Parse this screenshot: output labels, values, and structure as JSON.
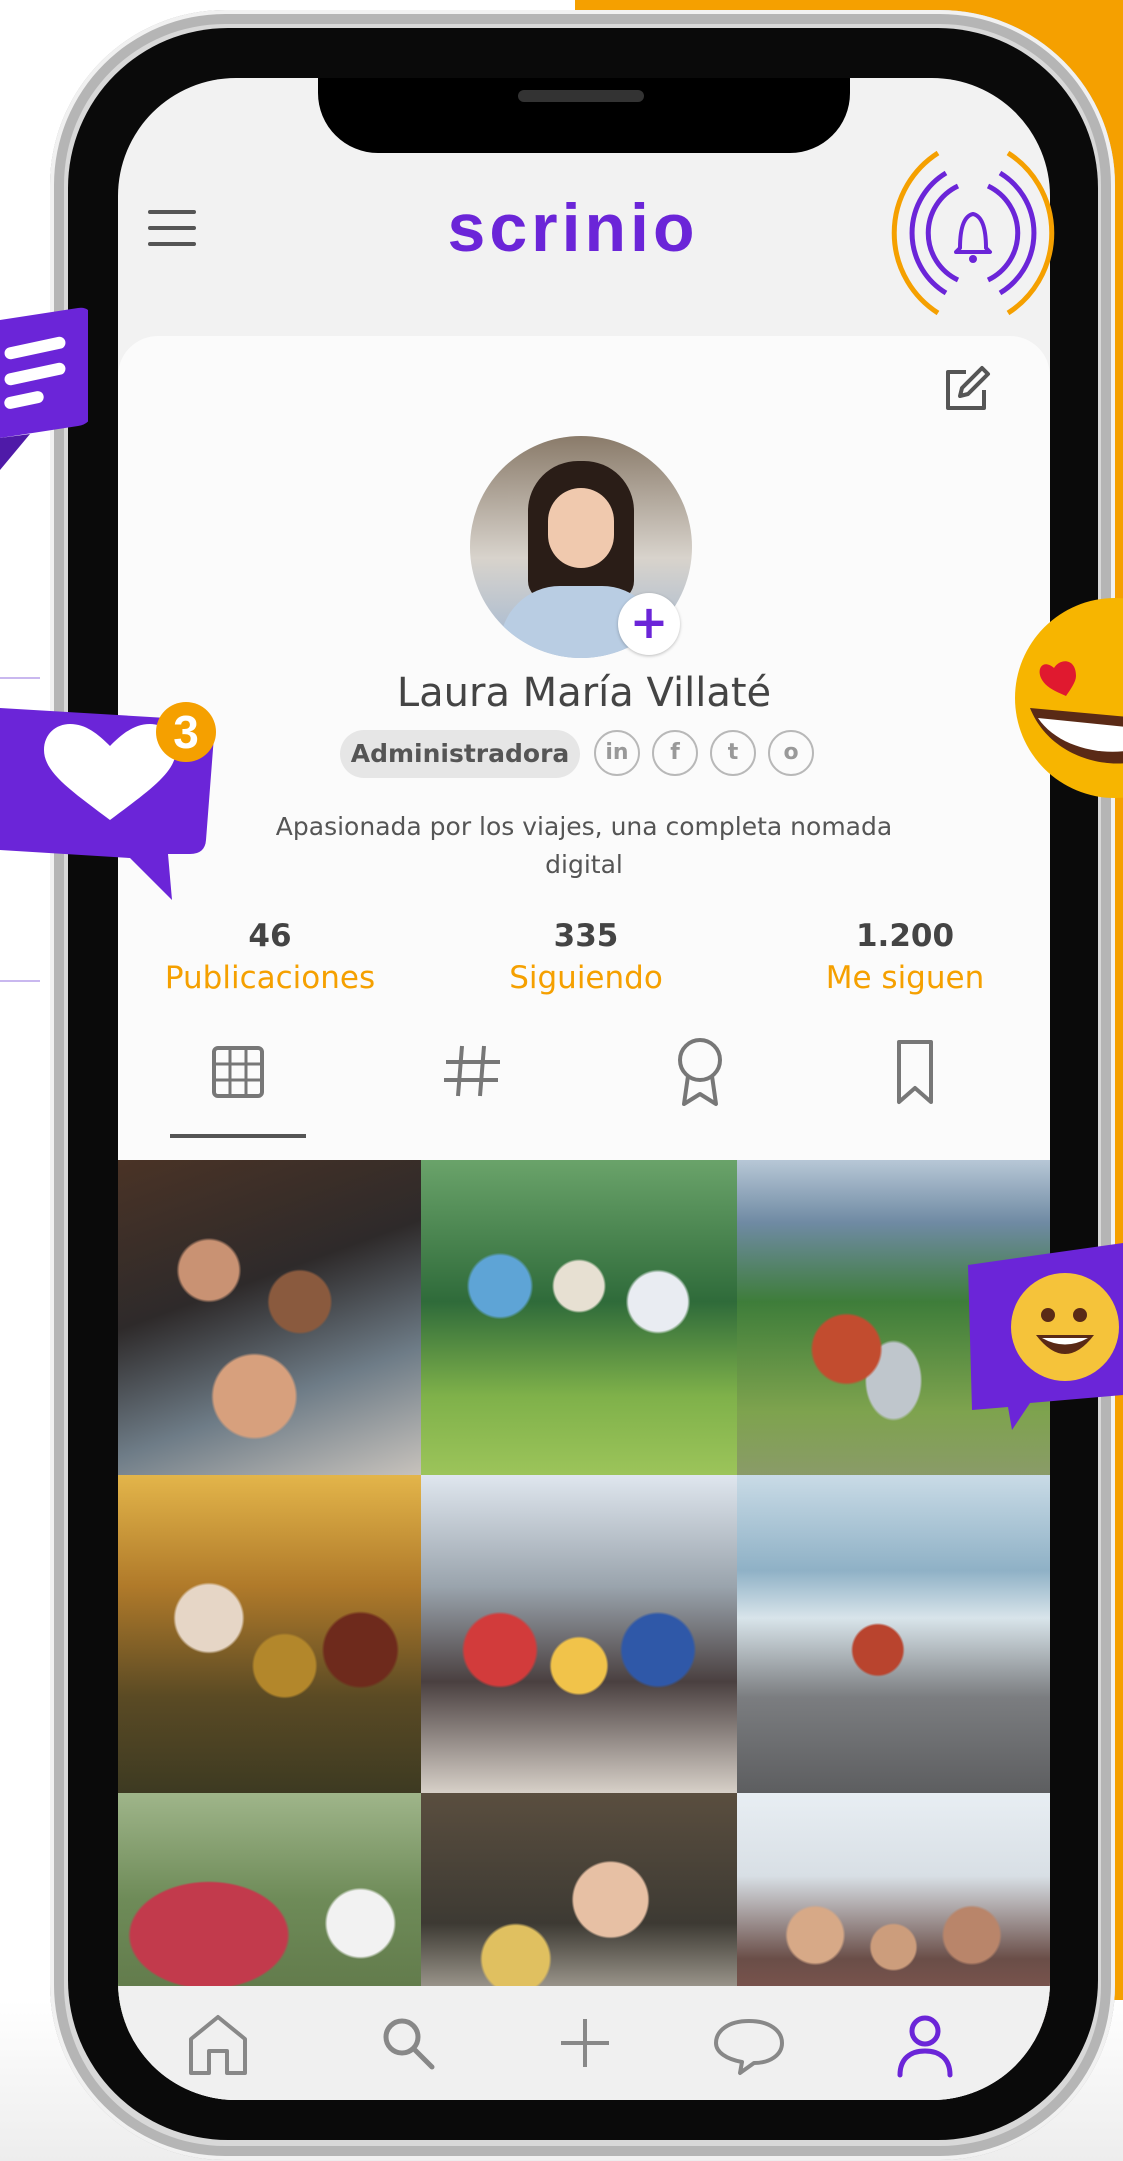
{
  "app": {
    "logo_text": "scrinio",
    "brand_color": "#6b25d8",
    "accent_color": "#f5a000"
  },
  "header": {
    "menu_icon": "hamburger-menu-icon",
    "notification_icon": "bell-icon",
    "edit_icon": "edit-icon"
  },
  "profile": {
    "name": "Laura María Villaté",
    "role": "Administradora",
    "add_photo_icon": "plus-icon",
    "bio": "Apasionada por los viajes, una completa nomada digital",
    "social": [
      {
        "icon": "linkedin-icon",
        "glyph": "in"
      },
      {
        "icon": "facebook-icon",
        "glyph": "f"
      },
      {
        "icon": "twitter-icon",
        "glyph": "t"
      },
      {
        "icon": "instagram-icon",
        "glyph": "o"
      }
    ]
  },
  "stats": [
    {
      "value": "46",
      "label": "Publicaciones"
    },
    {
      "value": "335",
      "label": "Siguiendo"
    },
    {
      "value": "1.200",
      "label": "Me siguen"
    }
  ],
  "tabs": [
    {
      "icon": "grid-icon",
      "active": true
    },
    {
      "icon": "hashtag-icon",
      "active": false
    },
    {
      "icon": "award-ribbon-icon",
      "active": false
    },
    {
      "icon": "bookmark-icon",
      "active": false
    }
  ],
  "posts": [
    "group-selfie-friends",
    "friends-sitting-on-grass-with-phones",
    "woman-with-laptop-in-park",
    "friends-dancing-at-sunset",
    "friends-looking-at-phones",
    "woman-with-laptop-on-beach",
    "woman-working-near-tent",
    "woman-with-earrings",
    "group-of-friends-outdoors"
  ],
  "bottom_nav": [
    {
      "icon": "home-icon",
      "active": false
    },
    {
      "icon": "search-icon",
      "active": false
    },
    {
      "icon": "plus-icon",
      "active": false
    },
    {
      "icon": "chat-icon",
      "active": false
    },
    {
      "icon": "user-icon",
      "active": true
    }
  ],
  "decorations": {
    "like_badge_count": "3"
  }
}
